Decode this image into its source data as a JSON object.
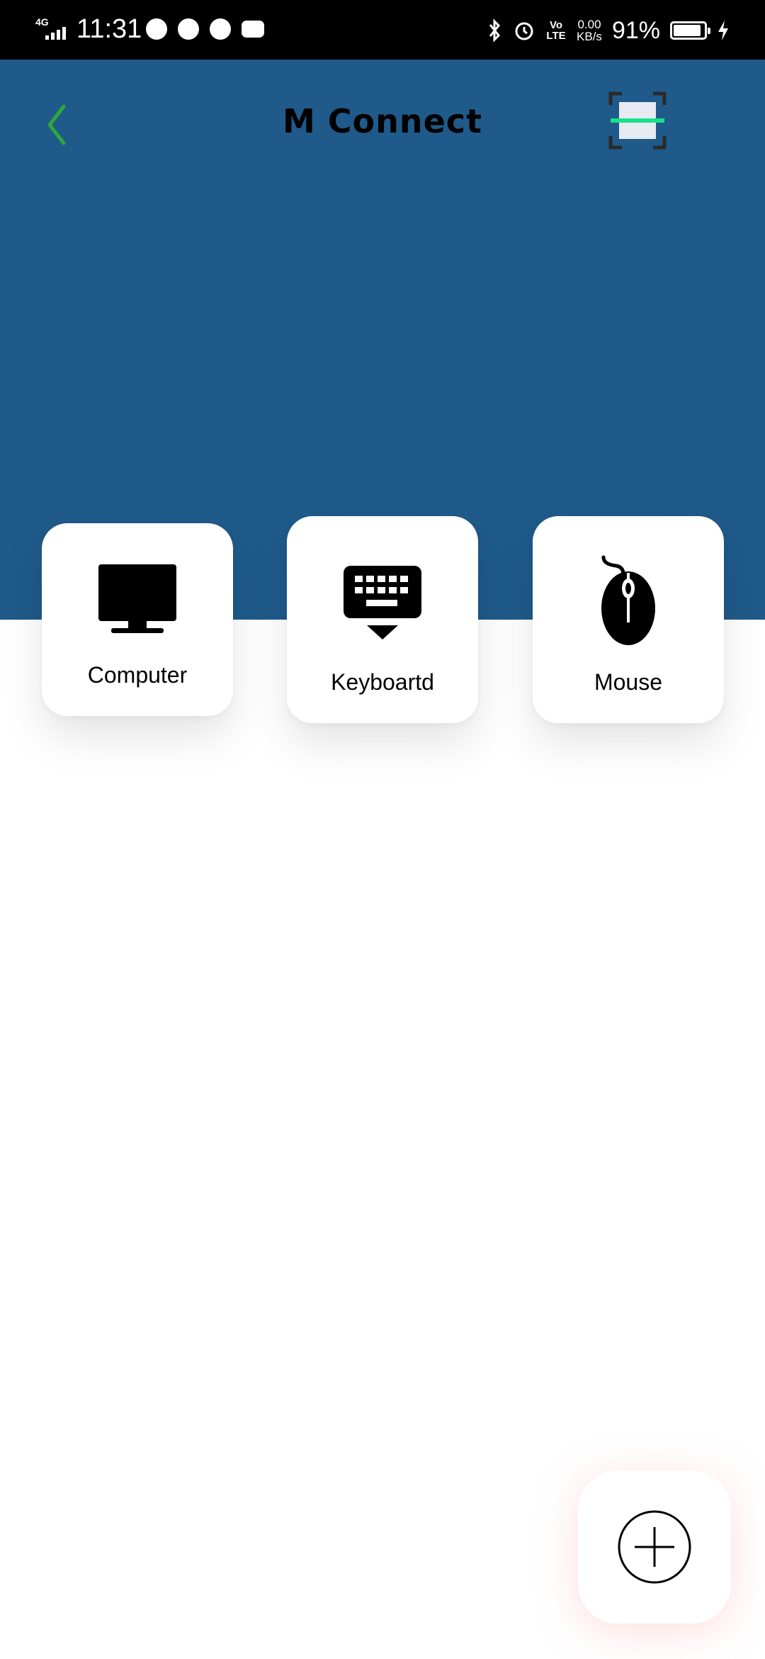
{
  "status_bar": {
    "network": "4G",
    "time": "11:31",
    "volte": "Vo LTE",
    "speed_value": "0.00",
    "speed_unit": "KB/s",
    "battery": "91%",
    "battery_level": 0.91
  },
  "header": {
    "title": "M Connect",
    "back_icon": "chevron-left-icon",
    "scan_icon": "qr-scan-icon"
  },
  "cards": [
    {
      "label": "Computer",
      "icon": "monitor-icon"
    },
    {
      "label": "Keyboartd",
      "icon": "keyboard-icon"
    },
    {
      "label": "Mouse",
      "icon": "mouse-icon"
    }
  ],
  "fab": {
    "icon": "add-circle-icon"
  },
  "colors": {
    "header_bg": "#1f5a8a",
    "back_accent": "#2ea83a",
    "scan_line": "#19e08a"
  }
}
